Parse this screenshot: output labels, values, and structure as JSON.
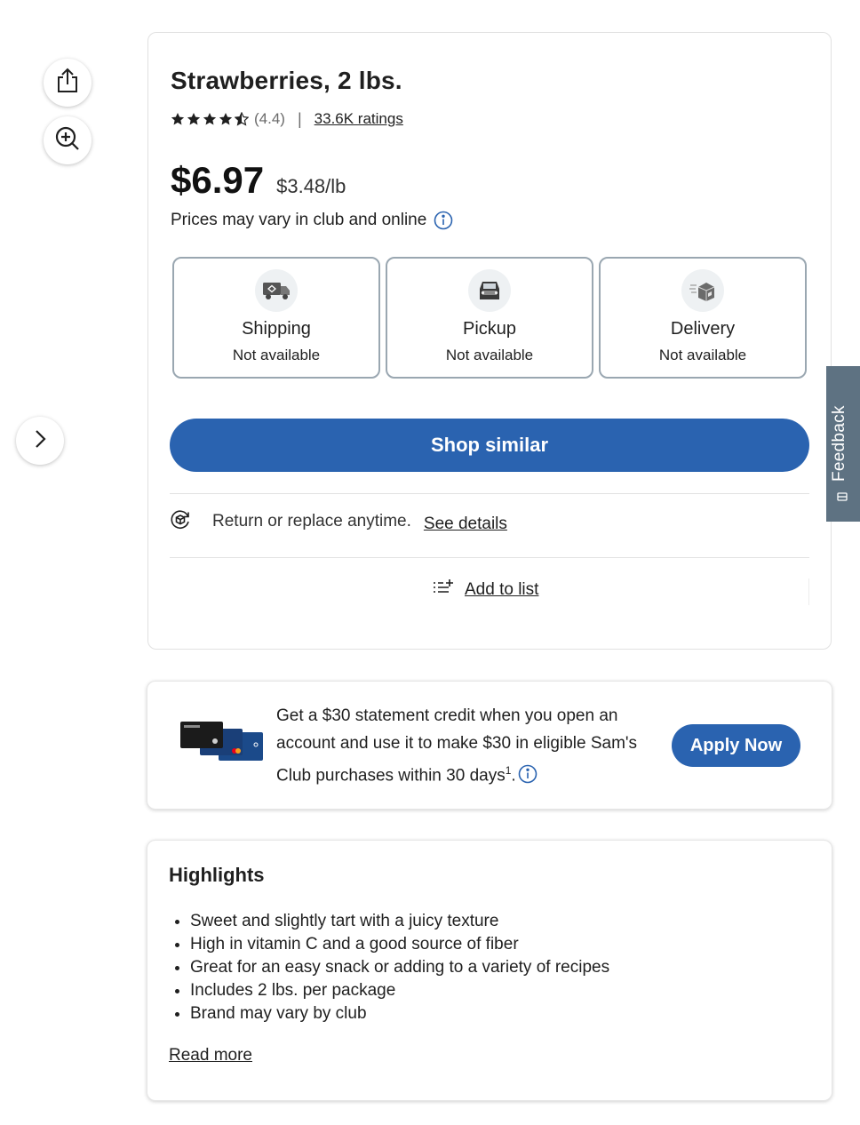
{
  "product": {
    "title": "Strawberries, 2 lbs.",
    "rating": "(4.4)",
    "rating_separator": "|",
    "ratings_count": "33.6K ratings",
    "star_rating": 4.4,
    "price": "$6.97",
    "unit_price": "$3.48/lb",
    "price_note": "Prices may vary in club and online"
  },
  "fulfillment": [
    {
      "label": "Shipping",
      "status": "Not available",
      "icon": "shipping-truck-icon"
    },
    {
      "label": "Pickup",
      "status": "Not available",
      "icon": "pickup-car-icon"
    },
    {
      "label": "Delivery",
      "status": "Not available",
      "icon": "delivery-box-icon"
    }
  ],
  "actions": {
    "shop_similar": "Shop similar",
    "return_text": "Return or replace anytime.",
    "see_details": "See details",
    "add_to_list": "Add to list"
  },
  "promo": {
    "text": "Get a $30 statement credit when you open an account and use it to make $30 in eligible Sam's Club purchases within 30 days",
    "superscript": "1",
    "period": ".",
    "apply_button": "Apply Now"
  },
  "highlights": {
    "title": "Highlights",
    "items": [
      "Sweet and slightly tart with a juicy texture",
      "High in vitamin C and a good source of fiber",
      "Great for an easy snack or adding to a variety of recipes",
      "Includes 2 lbs. per package",
      "Brand may vary by club"
    ],
    "read_more": "Read more"
  },
  "feedback": {
    "label": "Feedback"
  },
  "colors": {
    "primary_blue": "#2a63b0",
    "border_gray": "#9aa7b1",
    "feedback_tab": "#5e7282"
  }
}
